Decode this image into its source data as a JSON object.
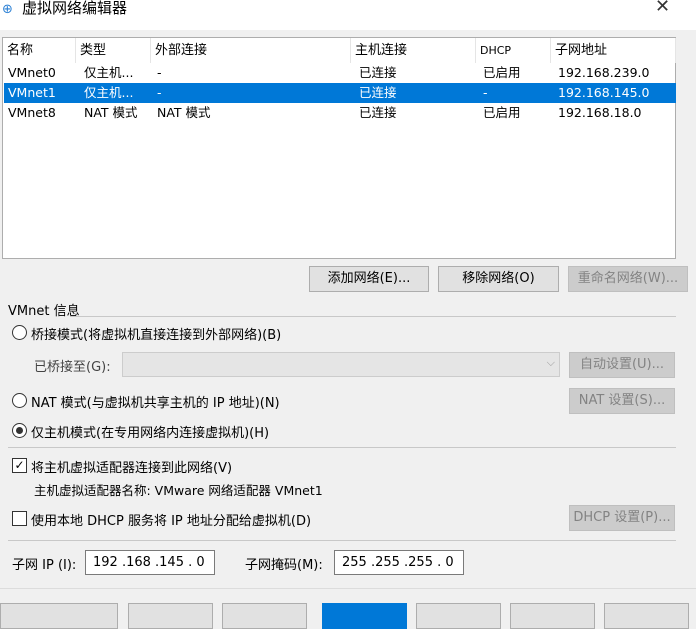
{
  "window": {
    "title": "虚拟网络编辑器",
    "close": "✕"
  },
  "table": {
    "headers": [
      "名称",
      "类型",
      "外部连接",
      "主机连接",
      "DHCP",
      "子网地址"
    ],
    "rows": [
      {
        "name": "VMnet0",
        "type": "仅主机...",
        "external": "-",
        "host": "已连接",
        "dhcp": "已启用",
        "subnet": "192.168.239.0"
      },
      {
        "name": "VMnet1",
        "type": "仅主机...",
        "external": "-",
        "host": "已连接",
        "dhcp": "-",
        "subnet": "192.168.145.0"
      },
      {
        "name": "VMnet8",
        "type": "NAT 模式",
        "external": "NAT 模式",
        "host": "已连接",
        "dhcp": "已启用",
        "subnet": "192.168.18.0"
      }
    ]
  },
  "buttons": {
    "add": "添加网络(E)...",
    "remove": "移除网络(O)",
    "rename": "重命名网络(W)..."
  },
  "info": {
    "group": "VMnet 信息",
    "bridged": "桥接模式(将虚拟机直接连接到外部网络)(B)",
    "bridged_to": "已桥接至(G):",
    "auto": "自动设置(U)...",
    "nat": "NAT 模式(与虚拟机共享主机的 IP 地址)(N)",
    "nat_settings": "NAT 设置(S)...",
    "hostonly": "仅主机模式(在专用网络内连接虚拟机)(H)",
    "connect_adapter": "将主机虚拟适配器连接到此网络(V)",
    "adapter_name": "主机虚拟适配器名称: VMware 网络适配器 VMnet1",
    "dhcp": "使用本地 DHCP 服务将 IP 地址分配给虚拟机(D)",
    "dhcp_settings": "DHCP 设置(P)...",
    "subnet_ip_label": "子网 IP (I):",
    "subnet_ip": "192 .168 .145 .  0",
    "mask_label": "子网掩码(M):",
    "mask": "255 .255 .255 .  0"
  }
}
